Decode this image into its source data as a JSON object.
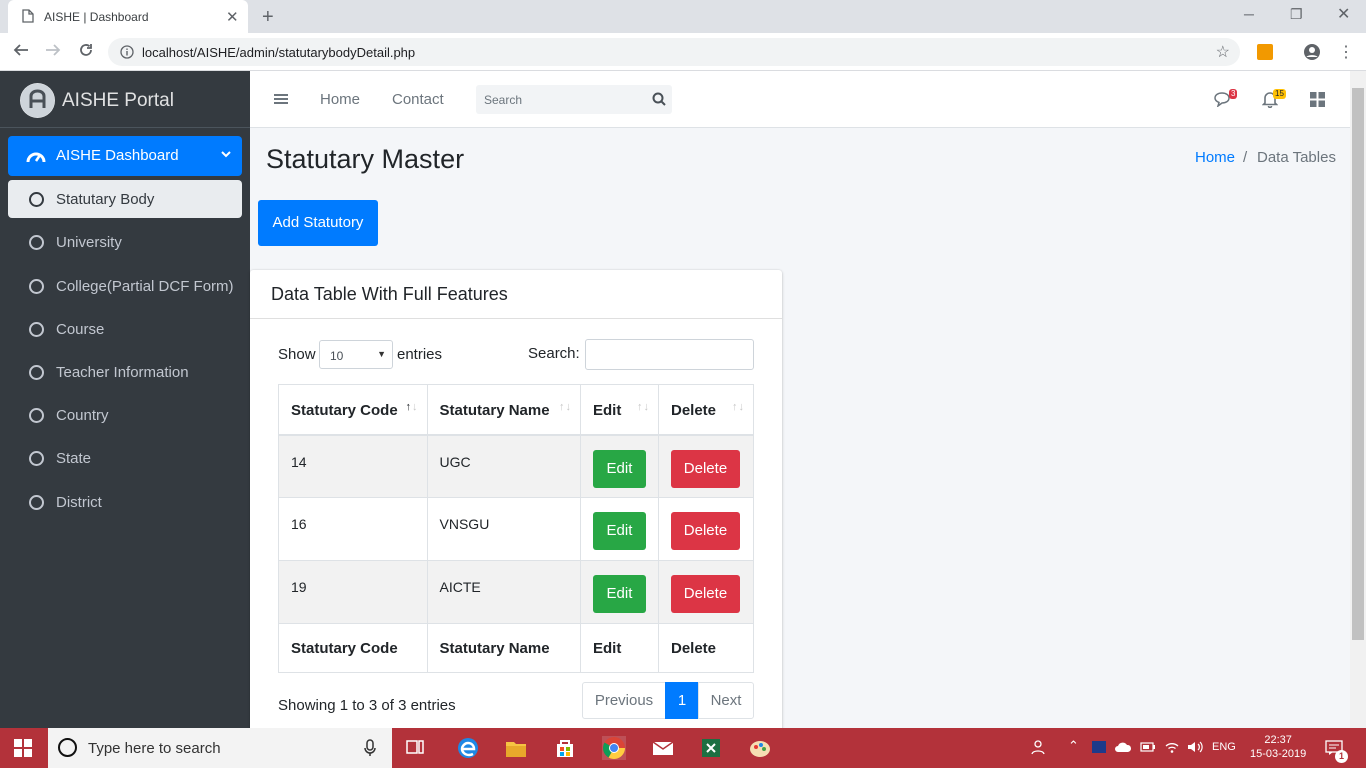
{
  "browser": {
    "tab_title": "AISHE | Dashboard",
    "url": "localhost/AISHE/admin/statutarybodyDetail.php"
  },
  "sidebar": {
    "brand": "AISHE Portal",
    "dashboard_label": "AISHE Dashboard",
    "items": [
      {
        "label": "Statutary Body",
        "active": true
      },
      {
        "label": "University"
      },
      {
        "label": "College(Partial DCF Form)"
      },
      {
        "label": "Course"
      },
      {
        "label": "Teacher Information"
      },
      {
        "label": "Country"
      },
      {
        "label": "State"
      },
      {
        "label": "District"
      }
    ]
  },
  "navbar": {
    "home": "Home",
    "contact": "Contact",
    "search_placeholder": "Search",
    "messages_count": "3",
    "notifications_count": "15"
  },
  "page": {
    "title": "Statutary Master",
    "breadcrumb_home": "Home",
    "breadcrumb_sep": "/",
    "breadcrumb_current": "Data Tables",
    "add_button": "Add Statutory"
  },
  "card": {
    "title": "Data Table With Full Features",
    "show_label": "Show",
    "length_value": "10",
    "entries_label": "entries",
    "search_label": "Search:"
  },
  "table": {
    "columns": [
      "Statutary Code",
      "Statutary Name",
      "Edit",
      "Delete"
    ],
    "rows": [
      {
        "code": "14",
        "name": "UGC"
      },
      {
        "code": "16",
        "name": "VNSGU"
      },
      {
        "code": "19",
        "name": "AICTE"
      }
    ],
    "edit_label": "Edit",
    "delete_label": "Delete",
    "info": "Showing 1 to 3 of 3 entries",
    "pager": {
      "prev": "Previous",
      "current": "1",
      "next": "Next"
    }
  },
  "taskbar": {
    "search_placeholder": "Type here to search",
    "lang": "ENG",
    "time": "22:37",
    "date": "15-03-2019",
    "notif_count": "1"
  },
  "colors": {
    "primary": "#007bff",
    "success": "#28a745",
    "danger": "#dc3545",
    "sidebar": "#343a40"
  }
}
